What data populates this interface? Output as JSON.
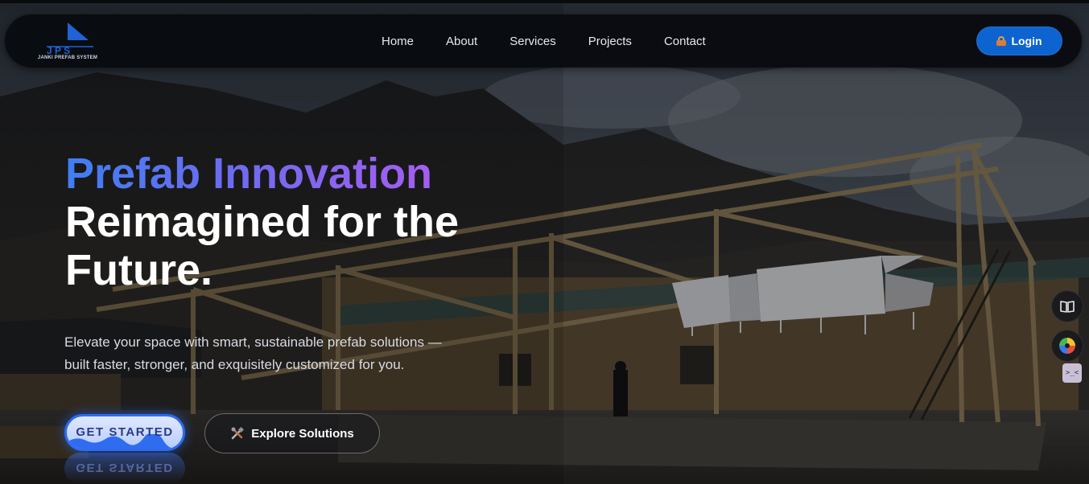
{
  "brand": {
    "logo_letters": "J P S",
    "logo_name": "JANKI PREFAB SYSTEM",
    "accent": "#0d63cf"
  },
  "nav": {
    "items": [
      "Home",
      "About",
      "Services",
      "Projects",
      "Contact"
    ],
    "login_label": "Login"
  },
  "hero": {
    "headline_gradient": "Prefab Innovation",
    "headline_rest": "Reimagined for the Future.",
    "subtitle_line1": "Elevate your space with smart, sustainable prefab solutions —",
    "subtitle_line2": "built faster, stronger, and exquisitely customized for you.",
    "cta_primary": "GET STARTED",
    "cta_secondary": "Explore Solutions"
  },
  "side_widgets": {
    "top_icon": "book-icon",
    "middle_icon": "color-wheel-icon",
    "bottom_label": ">_<"
  }
}
